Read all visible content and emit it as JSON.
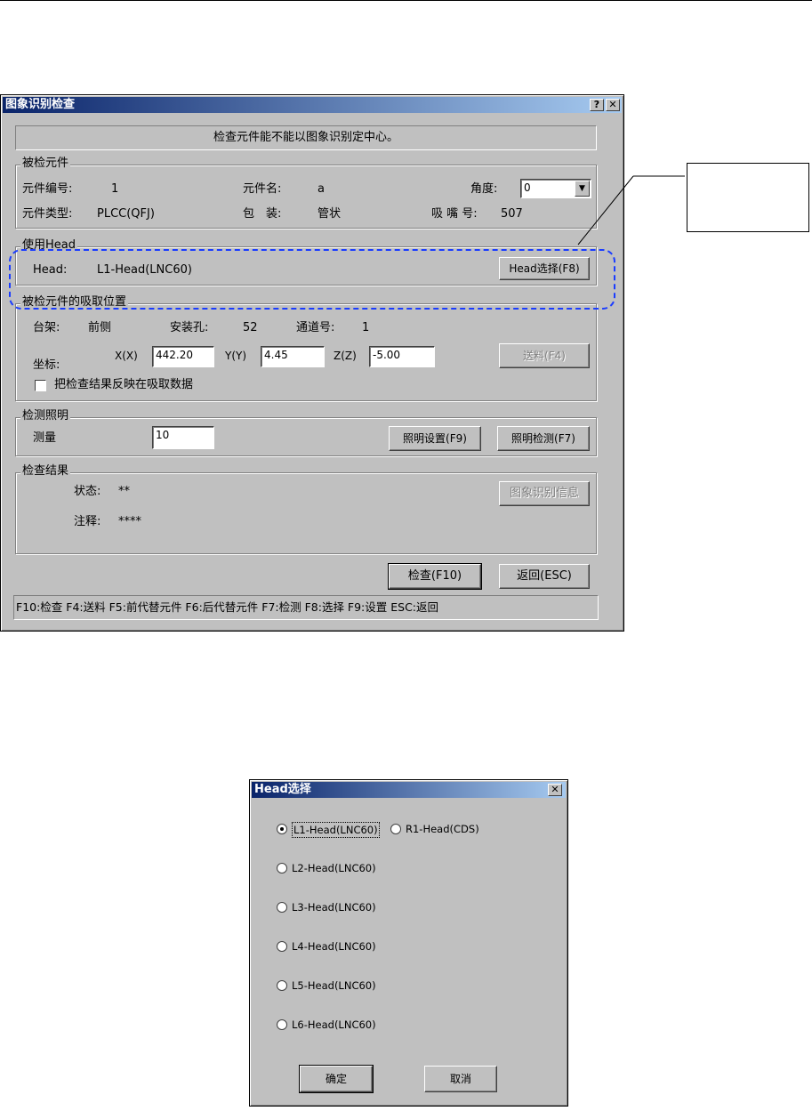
{
  "main_dialog": {
    "title": "图象识别检查",
    "help_btn": "?",
    "close_btn": "✕",
    "banner": "检查元件能不能以图象识别定中心。",
    "component_group": {
      "label": "被检元件",
      "part_no_label": "元件编号:",
      "part_no": "1",
      "name_label": "元件名:",
      "name": "a",
      "angle_label": "角度:",
      "angle": "0",
      "type_label": "元件类型:",
      "type": "PLCC(QFJ)",
      "package_label": "包　装:",
      "package": "管状",
      "nozzle_label": "吸 嘴 号:",
      "nozzle": "507"
    },
    "head_group": {
      "label": "使用Head",
      "head_label": "Head:",
      "head_value": "L1-Head(LNC60)",
      "select_button": "Head选择(F8)"
    },
    "pickup_group": {
      "label": "被检元件的吸取位置",
      "stage_label": "台架:",
      "stage": "前侧",
      "hole_label": "安装孔:",
      "hole": "52",
      "channel_label": "通道号:",
      "channel": "1",
      "coord_label": "坐标:",
      "x_label": "X(X)",
      "x_value": "442.20",
      "y_label": "Y(Y)",
      "y_value": "4.45",
      "z_label": "Z(Z)",
      "z_value": "-5.00",
      "feed_button": "送料(F4)",
      "reflect_checkbox": "把检查结果反映在吸取数据"
    },
    "lighting_group": {
      "label": "检测照明",
      "measure_label": "测量",
      "measure_value": "10",
      "setup_button": "照明设置(F9)",
      "detect_button": "照明检测(F7)"
    },
    "result_group": {
      "label": "检查结果",
      "status_label": "状态:",
      "status": "**",
      "note_label": "注释:",
      "note": "****",
      "info_button": "图象识别信息"
    },
    "check_button": "检查(F10)",
    "back_button": "返回(ESC)",
    "status_bar": "F10:检查 F4:送料 F5:前代替元件 F6:后代替元件 F7:检测 F8:选择 F9:设置 ESC:返回"
  },
  "head_dialog": {
    "title": "Head选择",
    "close_btn": "✕",
    "options": [
      {
        "label": "L1-Head(LNC60)",
        "selected": true
      },
      {
        "label": "R1-Head(CDS)",
        "selected": false
      },
      {
        "label": "L2-Head(LNC60)",
        "selected": false
      },
      {
        "label": "L3-Head(LNC60)",
        "selected": false
      },
      {
        "label": "L4-Head(LNC60)",
        "selected": false
      },
      {
        "label": "L5-Head(LNC60)",
        "selected": false
      },
      {
        "label": "L6-Head(LNC60)",
        "selected": false
      }
    ],
    "ok_button": "确定",
    "cancel_button": "取消"
  },
  "colors": {
    "face": "#c0c0c0",
    "title_start": "#0a246a",
    "title_end": "#a6caf0",
    "highlight_dash": "#1a3cff"
  }
}
